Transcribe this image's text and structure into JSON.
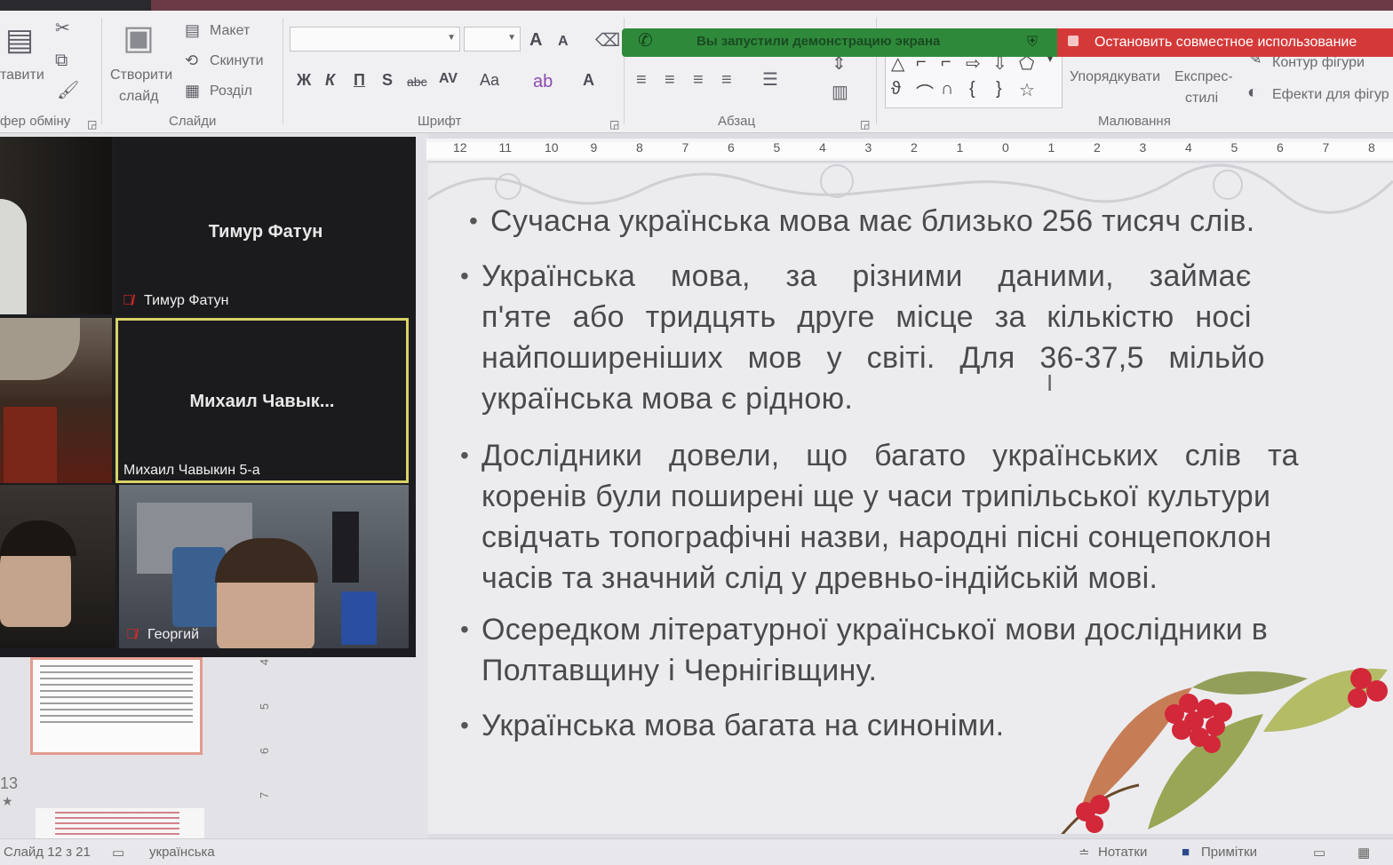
{
  "ribbon": {
    "clipboard": {
      "paste_label": "тавити",
      "group_label": "фер обміну"
    },
    "slides": {
      "new_slide_label_1": "Створити",
      "new_slide_label_2": "слайд",
      "layout_label": "Макет",
      "reset_label": "Скинути",
      "section_label": "Розділ",
      "group_label": "Слайди"
    },
    "font": {
      "bold": "Ж",
      "italic": "К",
      "underline": "П",
      "shadow": "S",
      "strike": "abc",
      "spacing": "AV",
      "case": "Aa",
      "grow": "A",
      "shrink": "A",
      "color": "A",
      "group_label": "Шрифт"
    },
    "paragraph": {
      "group_label": "Абзац"
    },
    "drawing": {
      "arrange_label": "Упорядкувати",
      "quick_styles_label_1": "Експрес-",
      "quick_styles_label_2": "стилі",
      "shape_outline_label": "Контур фігури",
      "shape_effects_label": "Ефекти для фігур",
      "group_label": "Малювання"
    }
  },
  "share": {
    "notice": "Вы запустили демонстрацию экрана",
    "stop_label": "Остановить совместное использование"
  },
  "ruler": {
    "ticks": [
      "12",
      "11",
      "10",
      "9",
      "8",
      "7",
      "6",
      "5",
      "4",
      "3",
      "2",
      "1",
      "0",
      "1",
      "2",
      "3",
      "4",
      "5",
      "6",
      "7",
      "8"
    ]
  },
  "vertical_ruler": {
    "ticks": [
      "4",
      "5",
      "6",
      "7"
    ]
  },
  "slide": {
    "bullets": [
      {
        "lines": [
          "Сучасна українська мова має близько 256 тисяч слів."
        ]
      },
      {
        "lines": [
          "Українська мова, за різними даними, займає",
          "п'яте або тридцять друге місце за кількістю носі",
          "найпоширеніших мов у світі. Для 36-37,5 мільйо",
          "українська мова є рідною."
        ]
      },
      {
        "lines": [
          "Дослідники довели, що багато українських слів та",
          "коренів були поширені ще у часи трипільської культури",
          "свідчать топографічні назви, народні пісні сонцепоклон",
          "часів та значний слід у древньо-індійській мові."
        ]
      },
      {
        "lines": [
          "Осередком літературної української мови дослідники в",
          "Полтавщину і Чернігівщину."
        ]
      },
      {
        "lines": [
          "Українська мова багата на синоніми."
        ]
      }
    ]
  },
  "thumbnails": {
    "next_slide_number": "13"
  },
  "video": {
    "tile_timur_big_name": "Тимур Фатун",
    "tile_timur_label": "Тимур Фатун",
    "tile_mikhail_big_name": "Михаил  Чавык...",
    "tile_mikhail_label": "Михаил Чавыкин 5-а",
    "tile_georgiy_label": "Георгий"
  },
  "status": {
    "slide_counter": "Слайд 12 з 21",
    "language": "українська",
    "notes_label": "Нотатки",
    "comments_label": "Примітки"
  },
  "colors": {
    "share_green": "#2e8a3a",
    "stop_red": "#d4393a",
    "active_speaker_border": "#d8d266",
    "mic_muted": "#e02828"
  }
}
